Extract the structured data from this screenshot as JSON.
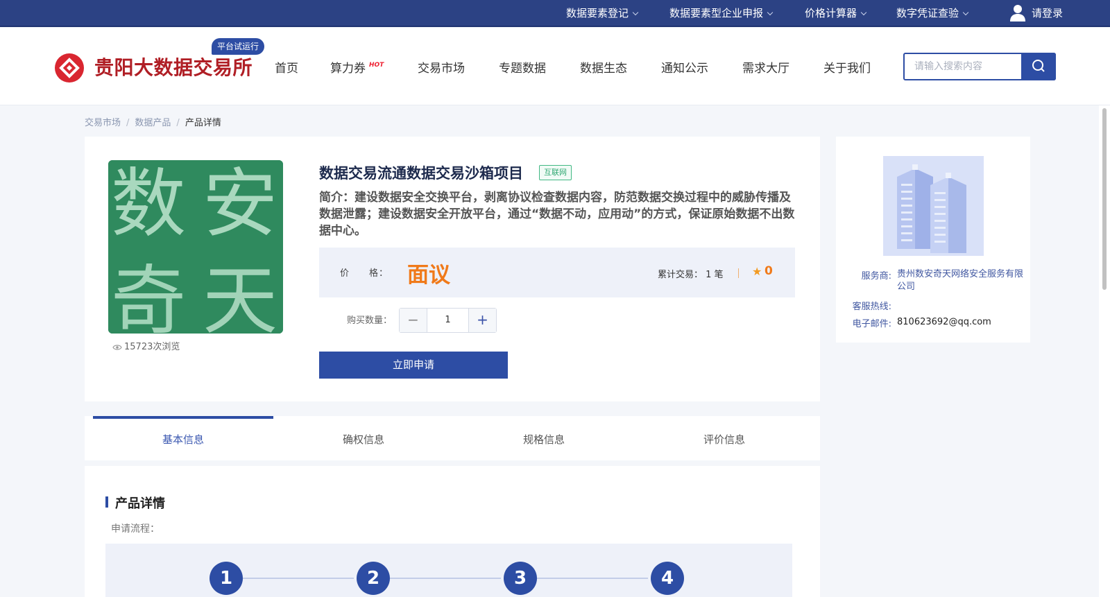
{
  "topbar": {
    "items": [
      {
        "label": "数据要素登记"
      },
      {
        "label": "数据要素型企业申报"
      },
      {
        "label": "价格计算器"
      },
      {
        "label": "数字凭证查验"
      }
    ],
    "login": "请登录"
  },
  "header": {
    "logo_text": "贵阳大数据交易所",
    "trial_badge": "平台试运行",
    "nav": [
      "首页",
      "算力券",
      "交易市场",
      "专题数据",
      "数据生态",
      "通知公示",
      "需求大厅",
      "关于我们"
    ],
    "hot_badge": "HOT",
    "search_placeholder": "请输入搜索内容"
  },
  "breadcrumb": {
    "items": [
      "交易市场",
      "数据产品",
      "产品详情"
    ],
    "separator": "/"
  },
  "product": {
    "thumb_chars": [
      "数",
      "安",
      "奇",
      "天"
    ],
    "views": "15723次浏览",
    "title": "数据交易流通数据交易沙箱项目",
    "tag": "互联网",
    "intro": "简介：建设数据安全交换平台，剥离协议检查数据内容，防范数据交换过程中的威胁传播及数据泄露；建设数据安全开放平台，通过“数据不动，应用动”的方式，保证原始数据不出数据中心。",
    "price_label": "价　　格：",
    "price_value": "面议",
    "trade_count": "累计交易： 1 笔",
    "rating": "0",
    "qty_label": "购买数量：",
    "qty_value": "1",
    "minus": "−",
    "plus": "+",
    "apply_button": "立即申请"
  },
  "provider": {
    "vendor_label": "服务商:",
    "vendor_value": "贵州数安奇天网络安全服务有限公司",
    "hotline_label": "客服热线:",
    "hotline_value": "",
    "email_label": "电子邮件:",
    "email_value": "810623692@qq.com"
  },
  "tabs": [
    "基本信息",
    "确权信息",
    "规格信息",
    "评价信息"
  ],
  "detail": {
    "section_title": "产品详情",
    "flow_label": "申请流程：",
    "steps": [
      "1",
      "2",
      "3",
      "4"
    ]
  },
  "colors": {
    "brand_blue": "#2d4da4",
    "topbar": "#2c4284",
    "price_orange": "#f07a1a",
    "logo_red": "#b01e25"
  }
}
